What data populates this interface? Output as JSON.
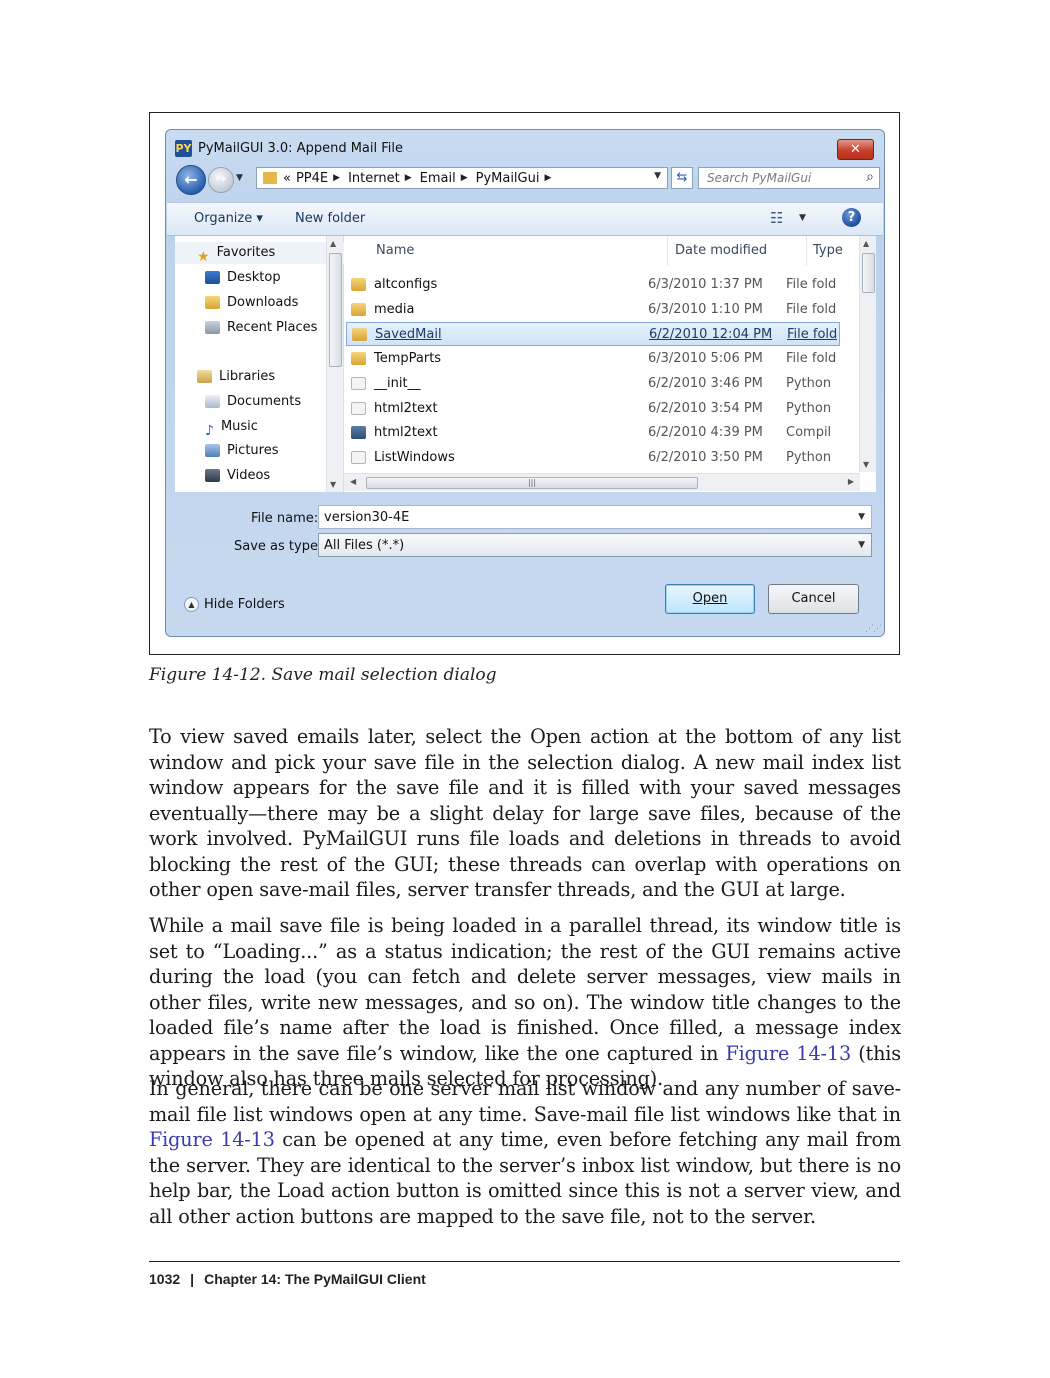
{
  "dialog": {
    "title": "PyMailGUI 3.0: Append Mail File",
    "app_icon_text": "PY",
    "close_glyph": "✕",
    "breadcrumb": {
      "prefix": "«",
      "items": [
        "PP4E",
        "Internet",
        "Email",
        "PyMailGui"
      ]
    },
    "search_placeholder": "Search PyMailGui",
    "toolbar": {
      "organize": "Organize ▾",
      "new_folder": "New folder",
      "help": "?"
    },
    "nav": {
      "favorites": "Favorites",
      "desktop": "Desktop",
      "downloads": "Downloads",
      "recent_places": "Recent Places",
      "libraries": "Libraries",
      "documents": "Documents",
      "music": "Music",
      "pictures": "Pictures",
      "videos": "Videos"
    },
    "columns": {
      "name": "Name",
      "date_modified": "Date modified",
      "type": "Type"
    },
    "files": [
      {
        "name": "altconfigs",
        "date": "6/3/2010 1:37 PM",
        "type": "File fold",
        "icon": "folder-icon"
      },
      {
        "name": "media",
        "date": "6/3/2010 1:10 PM",
        "type": "File fold",
        "icon": "folder-icon"
      },
      {
        "name": "SavedMail",
        "date": "6/2/2010 12:04 PM",
        "type": "File fold",
        "icon": "folder-icon",
        "selected": true
      },
      {
        "name": "TempParts",
        "date": "6/3/2010 5:06 PM",
        "type": "File fold",
        "icon": "folder-icon"
      },
      {
        "name": "__init__",
        "date": "6/2/2010 3:46 PM",
        "type": "Python",
        "icon": "python-file-icon"
      },
      {
        "name": "html2text",
        "date": "6/2/2010 3:54 PM",
        "type": "Python",
        "icon": "python-file-icon"
      },
      {
        "name": "html2text",
        "date": "6/2/2010 4:39 PM",
        "type": "Compil",
        "icon": "compiled-python-icon"
      },
      {
        "name": "ListWindows",
        "date": "6/2/2010 3:50 PM",
        "type": "Python",
        "icon": "python-file-icon"
      }
    ],
    "file_name_label": "File name:",
    "file_name_value": "version30-4E",
    "save_type_label": "Save as type:",
    "save_type_value": "All Files (*.*)",
    "hide_folders": "Hide Folders",
    "open_button": "Open",
    "cancel_button": "Cancel"
  },
  "caption": "Figure 14-12. Save mail selection dialog",
  "paragraphs": {
    "p1": "To view saved emails later, select the Open action at the bottom of any list window and pick your save file in the selection dialog. A new mail index list window appears for the save file and it is filled with your saved messages eventually—there may be a slight delay for large save files, because of the work involved. PyMailGUI runs file loads and deletions in threads to avoid blocking the rest of the GUI; these threads can overlap with operations on other open save-mail files, server transfer threads, and the GUI at large.",
    "p2_a": "While a mail save file is being loaded in a parallel thread, its window title is set to “Loading...” as a status indication; the rest of the GUI remains active during the load (you can fetch and delete server messages, view mails in other files, write new messages, and so on). The window title changes to the loaded file’s name after the load is finished. Once filled, a message index appears in the save file’s window, like the one captured in ",
    "p2_link": "Figure 14-13",
    "p2_b": " (this window also has three mails selected for processing).",
    "p3_a": "In general, there can be one server mail list window and any number of save-mail file list windows open at any time. Save-mail file list windows like that in ",
    "p3_link": "Figure 14-13",
    "p3_b": " can be opened at any time, even before fetching any mail from the server. They are identical to the server’s inbox list window, but there is no help bar, the Load action button is omitted since this is not a server view, and all other action buttons are mapped to the save file, not to the server."
  },
  "footer": {
    "page_number": "1032",
    "separator": "|",
    "chapter": "Chapter 14: The PyMailGUI Client"
  }
}
